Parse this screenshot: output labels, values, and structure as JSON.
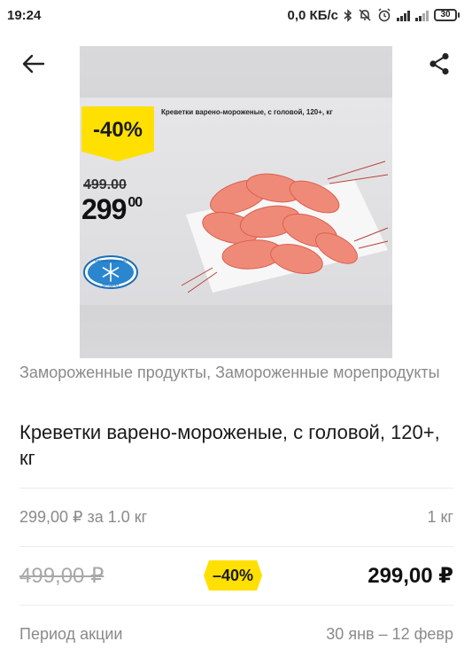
{
  "status_bar": {
    "time": "19:24",
    "net_speed": "0,0 КБ/с",
    "battery": "30"
  },
  "icons": {
    "back": "arrow-left-icon",
    "share": "share-icon"
  },
  "image": {
    "title": "Креветки варено-мороженые, с головой, 120+, кг",
    "discount": "-40%",
    "old_price": "499.00",
    "new_price_main": "299",
    "new_price_cents": "00",
    "frozen_badge_top": "ЗАМОРОЖЕННЫЙ",
    "frozen_badge_bottom": "ПРОДУКТ"
  },
  "product": {
    "category": "Замороженные продукты, Замороженные морепродукты",
    "title": "Креветки варено-мороженые, с головой, 120+, кг",
    "unit_price": "299,00 ₽ за 1.0 кг",
    "unit_weight": "1 кг",
    "old_price": "499,00 ₽",
    "discount": "–40%",
    "new_price": "299,00 ₽",
    "promo_label": "Период акции",
    "promo_dates": "30 янв – 12 февр"
  },
  "colors": {
    "accent_yellow": "#ffe000",
    "muted_text": "#8a8a8a"
  }
}
